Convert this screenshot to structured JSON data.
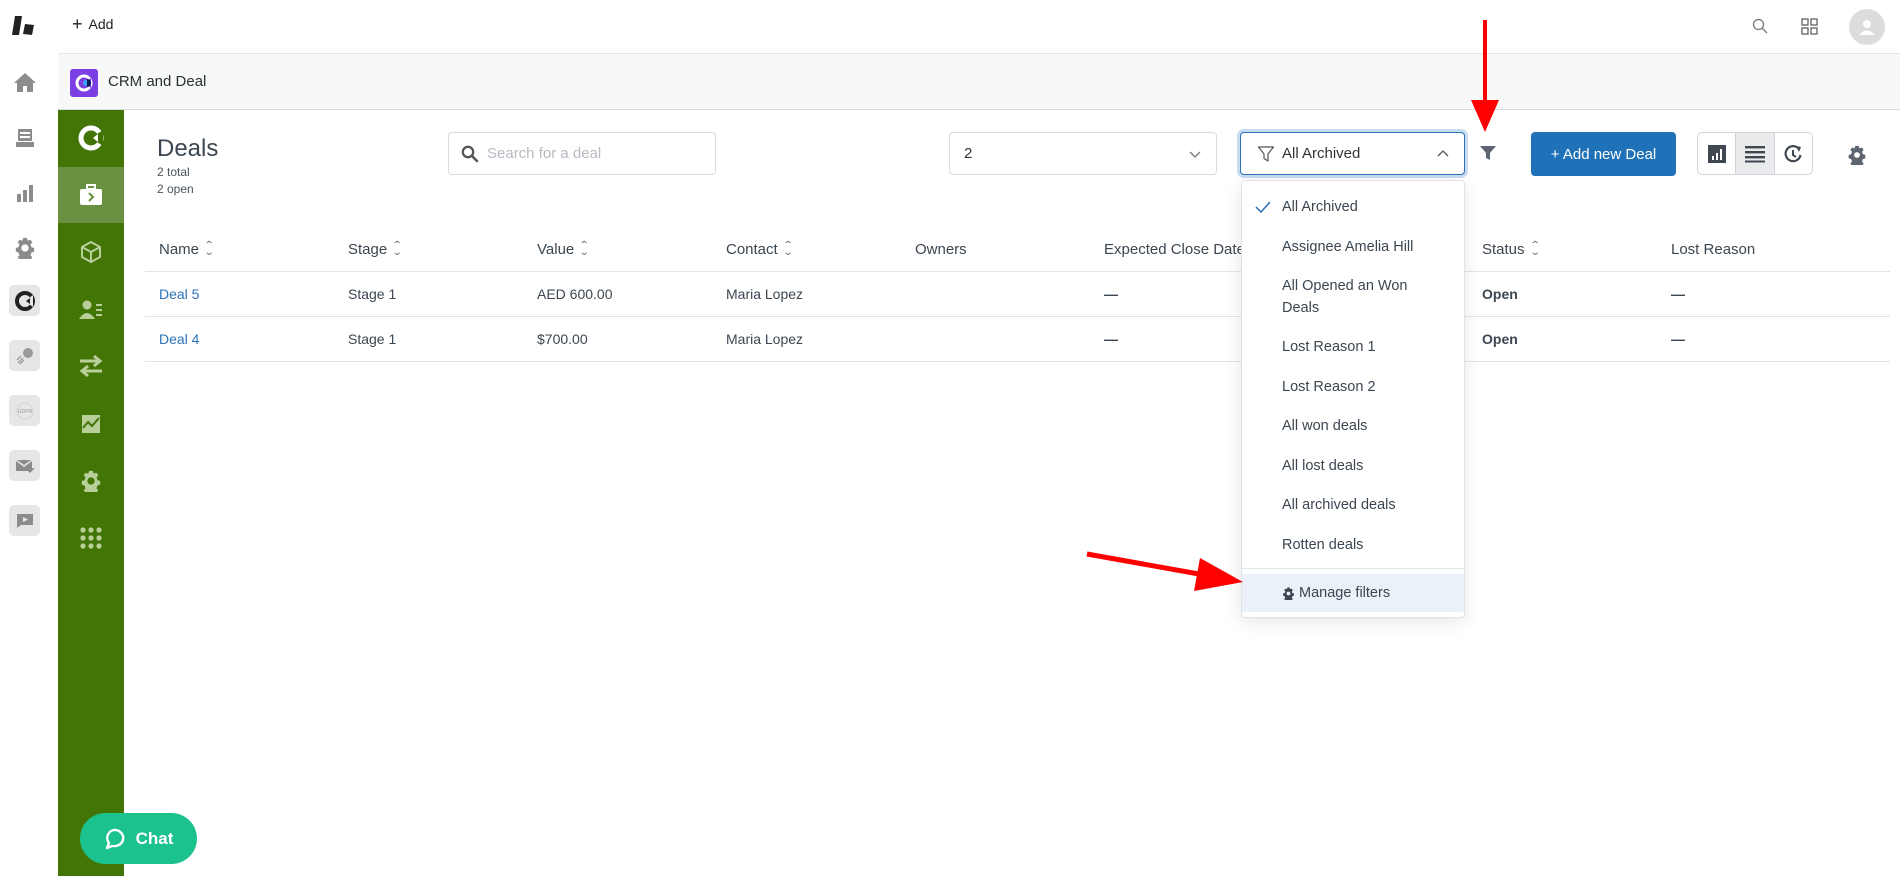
{
  "topbar": {
    "add_label": "Add",
    "icons": [
      "logo-icon",
      "search-icon",
      "apps-grid-icon",
      "user-avatar-icon"
    ]
  },
  "rail": {
    "items": [
      "home-icon",
      "inbox-icon",
      "bar-chart-icon",
      "gear-icon",
      "crm-app-icon",
      "analytics-app-icon",
      "gdpr-app-icon",
      "email-app-icon",
      "video-app-icon"
    ]
  },
  "app": {
    "title": "CRM and Deal"
  },
  "sidebar": {
    "items": [
      {
        "icon": "crm-logo-icon",
        "active": false
      },
      {
        "icon": "deals-briefcase-icon",
        "active": true
      },
      {
        "icon": "products-box-icon",
        "active": false
      },
      {
        "icon": "contacts-icon",
        "active": false
      },
      {
        "icon": "transfers-icon",
        "active": false
      },
      {
        "icon": "reports-chart-icon",
        "active": false
      },
      {
        "icon": "settings-gear-icon",
        "active": false
      },
      {
        "icon": "apps-dots-icon",
        "active": false
      }
    ]
  },
  "page": {
    "title": "Deals",
    "total": "2 total",
    "open": "2 open"
  },
  "search": {
    "placeholder": "Search for a deal",
    "value": ""
  },
  "pipeline_select": {
    "value": "2"
  },
  "filter_select": {
    "value": "All Archived",
    "expanded": true
  },
  "actions": {
    "add_deal_label": "+ Add new Deal",
    "views": [
      {
        "name": "chart-view",
        "active": false
      },
      {
        "name": "list-view",
        "active": true
      },
      {
        "name": "timeline-view",
        "active": false
      }
    ]
  },
  "table": {
    "columns": [
      {
        "label": "Name",
        "sortable": true
      },
      {
        "label": "Stage",
        "sortable": true
      },
      {
        "label": "Value",
        "sortable": true
      },
      {
        "label": "Contact",
        "sortable": true
      },
      {
        "label": "Owners",
        "sortable": false
      },
      {
        "label": "Expected Close Date",
        "sortable": false
      },
      {
        "label": "Status",
        "sortable": true
      },
      {
        "label": "Lost Reason",
        "sortable": false
      }
    ],
    "rows": [
      {
        "name": "Deal 5",
        "stage": "Stage 1",
        "value": "AED 600.00",
        "contact": "Maria Lopez",
        "owners": "",
        "close_date": "—",
        "status": "Open",
        "lost_reason": "—"
      },
      {
        "name": "Deal 4",
        "stage": "Stage 1",
        "value": "$700.00",
        "contact": "Maria Lopez",
        "owners": "",
        "close_date": "—",
        "status": "Open",
        "lost_reason": "—"
      }
    ]
  },
  "filter_menu": {
    "items": [
      {
        "label": "All Archived",
        "selected": true
      },
      {
        "label": "Assignee Amelia Hill",
        "selected": false
      },
      {
        "label": "All Opened an Won Deals",
        "selected": false
      },
      {
        "label": "Lost Reason 1",
        "selected": false
      },
      {
        "label": "Lost Reason 2",
        "selected": false
      },
      {
        "label": "All won deals",
        "selected": false
      },
      {
        "label": "All lost deals",
        "selected": false
      },
      {
        "label": "All archived deals",
        "selected": false
      },
      {
        "label": "Rotten deals",
        "selected": false
      }
    ],
    "manage_label": "Manage filters"
  },
  "chat": {
    "label": "Chat"
  },
  "colors": {
    "sidebar_green": "#437506",
    "sidebar_active": "#6a9141",
    "primary_blue": "#1f72b8",
    "link_blue": "#2b72b9",
    "chat_green": "#1cc28e",
    "app_logo_purple": "#7b3fe4",
    "annotation_red": "#ff0000"
  }
}
